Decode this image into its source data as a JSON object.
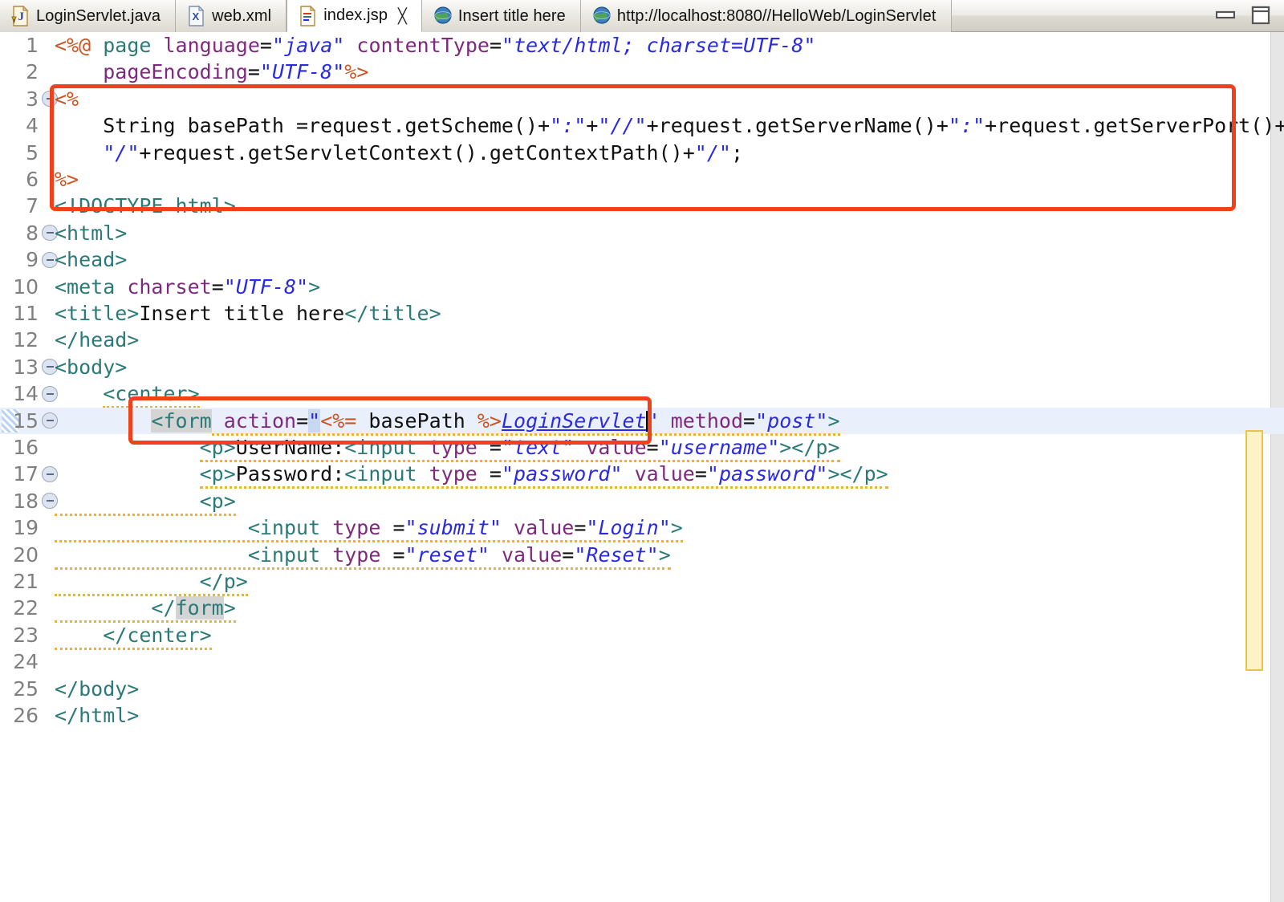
{
  "window": {
    "minimize_label": "minimize",
    "restore_label": "restore"
  },
  "tabs": [
    {
      "label": "LoginServlet.java",
      "icon": "java-file-icon",
      "active": false,
      "closable": false,
      "has_warning": true
    },
    {
      "label": "web.xml",
      "icon": "xml-file-icon",
      "active": false,
      "closable": false,
      "has_warning": false
    },
    {
      "label": "index.jsp",
      "icon": "jsp-file-icon",
      "active": true,
      "closable": true,
      "close_glyph": "╳",
      "has_warning": false
    },
    {
      "label": "Insert title here",
      "icon": "browser-globe-icon",
      "active": false,
      "closable": false,
      "has_warning": false
    },
    {
      "label": "http://localhost:8080//HelloWeb/LoginServlet",
      "icon": "browser-globe-icon",
      "active": false,
      "closable": false,
      "has_warning": false
    }
  ],
  "editor": {
    "file": "index.jsp",
    "current_line": 15,
    "lines": [
      {
        "n": "1",
        "fold": false,
        "marker": "none"
      },
      {
        "n": "2",
        "fold": false,
        "marker": "none"
      },
      {
        "n": "3",
        "fold": true,
        "marker": "none"
      },
      {
        "n": "4",
        "fold": false,
        "marker": "none"
      },
      {
        "n": "5",
        "fold": false,
        "marker": "none"
      },
      {
        "n": "6",
        "fold": false,
        "marker": "none"
      },
      {
        "n": "7",
        "fold": false,
        "marker": "none"
      },
      {
        "n": "8",
        "fold": true,
        "marker": "none"
      },
      {
        "n": "9",
        "fold": true,
        "marker": "none"
      },
      {
        "n": "10",
        "fold": false,
        "marker": "none"
      },
      {
        "n": "11",
        "fold": false,
        "marker": "none"
      },
      {
        "n": "12",
        "fold": false,
        "marker": "none"
      },
      {
        "n": "13",
        "fold": true,
        "marker": "none"
      },
      {
        "n": "14",
        "fold": true,
        "marker": "warning"
      },
      {
        "n": "15",
        "fold": true,
        "marker": "change"
      },
      {
        "n": "16",
        "fold": false,
        "marker": "none"
      },
      {
        "n": "17",
        "fold": true,
        "marker": "none"
      },
      {
        "n": "18",
        "fold": true,
        "marker": "none"
      },
      {
        "n": "19",
        "fold": false,
        "marker": "none"
      },
      {
        "n": "20",
        "fold": false,
        "marker": "none"
      },
      {
        "n": "21",
        "fold": false,
        "marker": "none"
      },
      {
        "n": "22",
        "fold": false,
        "marker": "none"
      },
      {
        "n": "23",
        "fold": false,
        "marker": "none"
      },
      {
        "n": "24",
        "fold": false,
        "marker": "none"
      },
      {
        "n": "25",
        "fold": false,
        "marker": "none"
      },
      {
        "n": "26",
        "fold": false,
        "marker": "none"
      }
    ],
    "source_text": [
      "<%@ page language=\"java\" contentType=\"text/html; charset=UTF-8\"",
      "    pageEncoding=\"UTF-8\"%>",
      "<%",
      "    String basePath =request.getScheme()+\":\"+\"//\"+request.getServerName()+\":\"+request.getServerPort()+",
      "    \"/\"+request.getServletContext().getContextPath()+\"/\";",
      "%>",
      "<!DOCTYPE html>",
      "<html>",
      "<head>",
      "<meta charset=\"UTF-8\">",
      "<title>Insert title here</title>",
      "</head>",
      "<body>",
      "    <center>",
      "        <form action=\"<%= basePath %>LoginServlet\" method=\"post\">",
      "            <p>UserName:<input type =\"text\" value=\"username\"></p>",
      "            <p>Password:<input type =\"password\" value=\"password\"></p>",
      "            <p>",
      "                <input type =\"submit\" value=\"Login\">",
      "                <input type =\"reset\" value=\"Reset\">",
      "            </p>",
      "        </form>",
      "    </center>",
      "",
      "</body>",
      "</html>"
    ]
  },
  "annotations": [
    {
      "name": "jsp-scriptlet-highlight",
      "color": "#f0411d",
      "covers_lines": "3-6"
    },
    {
      "name": "form-action-highlight",
      "color": "#f0411d",
      "covers_lines": "15"
    }
  ],
  "colors": {
    "annotation_red": "#f0411d",
    "tag": "#2b7a78",
    "attribute": "#7d2a7d",
    "string": "#2a2ae0",
    "jsp_delimiter": "#cc5522",
    "current_line_bg": "#eaf0fb",
    "occurrence_bar": "#fdf3c9"
  }
}
